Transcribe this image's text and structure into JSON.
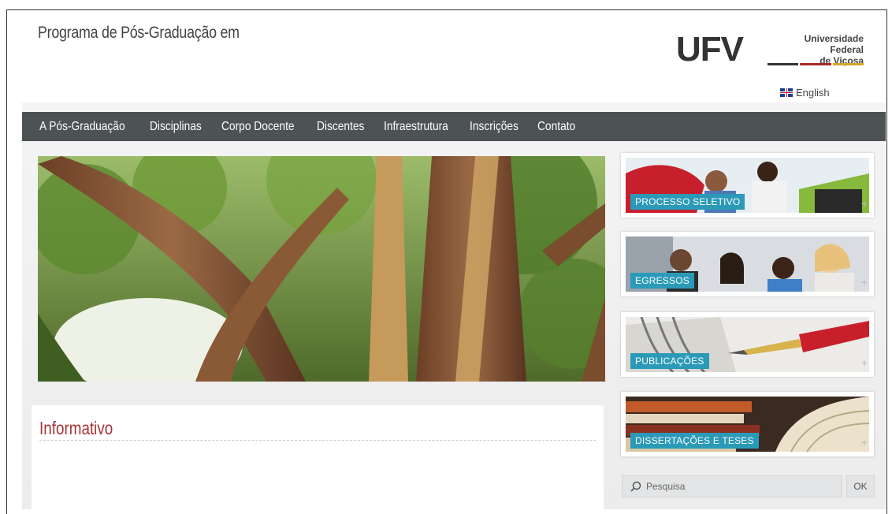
{
  "header": {
    "site_title": "Programa de Pós-Graduação em",
    "logo": {
      "mark": "UFV",
      "name_line1": "Universidade Federal",
      "name_line2": "de Viçosa",
      "bar_colors": [
        "#333333",
        "#a52a2a",
        "#d4a72c"
      ]
    },
    "language_link": "English"
  },
  "nav": {
    "items": [
      {
        "label": "A Pós-Graduação"
      },
      {
        "label": "Disciplinas"
      },
      {
        "label": "Corpo Docente"
      },
      {
        "label": "Discentes"
      },
      {
        "label": "Infraestrutura"
      },
      {
        "label": "Inscrições"
      },
      {
        "label": "Contato"
      }
    ]
  },
  "info": {
    "title": "Informativo"
  },
  "cards": [
    {
      "label": "PROCESSO SELETIVO",
      "icon": "plus-icon"
    },
    {
      "label": "EGRESSOS",
      "icon": "plus-icon"
    },
    {
      "label": "PUBLICAÇÕES",
      "icon": "plus-icon"
    },
    {
      "label": "DISSERTAÇÕES E TESES",
      "icon": "plus-icon"
    }
  ],
  "search": {
    "placeholder": "Pesquisa",
    "button_label": "OK"
  },
  "colors": {
    "nav_bg": "#4d5254",
    "accent_red": "#a73238",
    "label_blue": "#2b9ab8"
  }
}
